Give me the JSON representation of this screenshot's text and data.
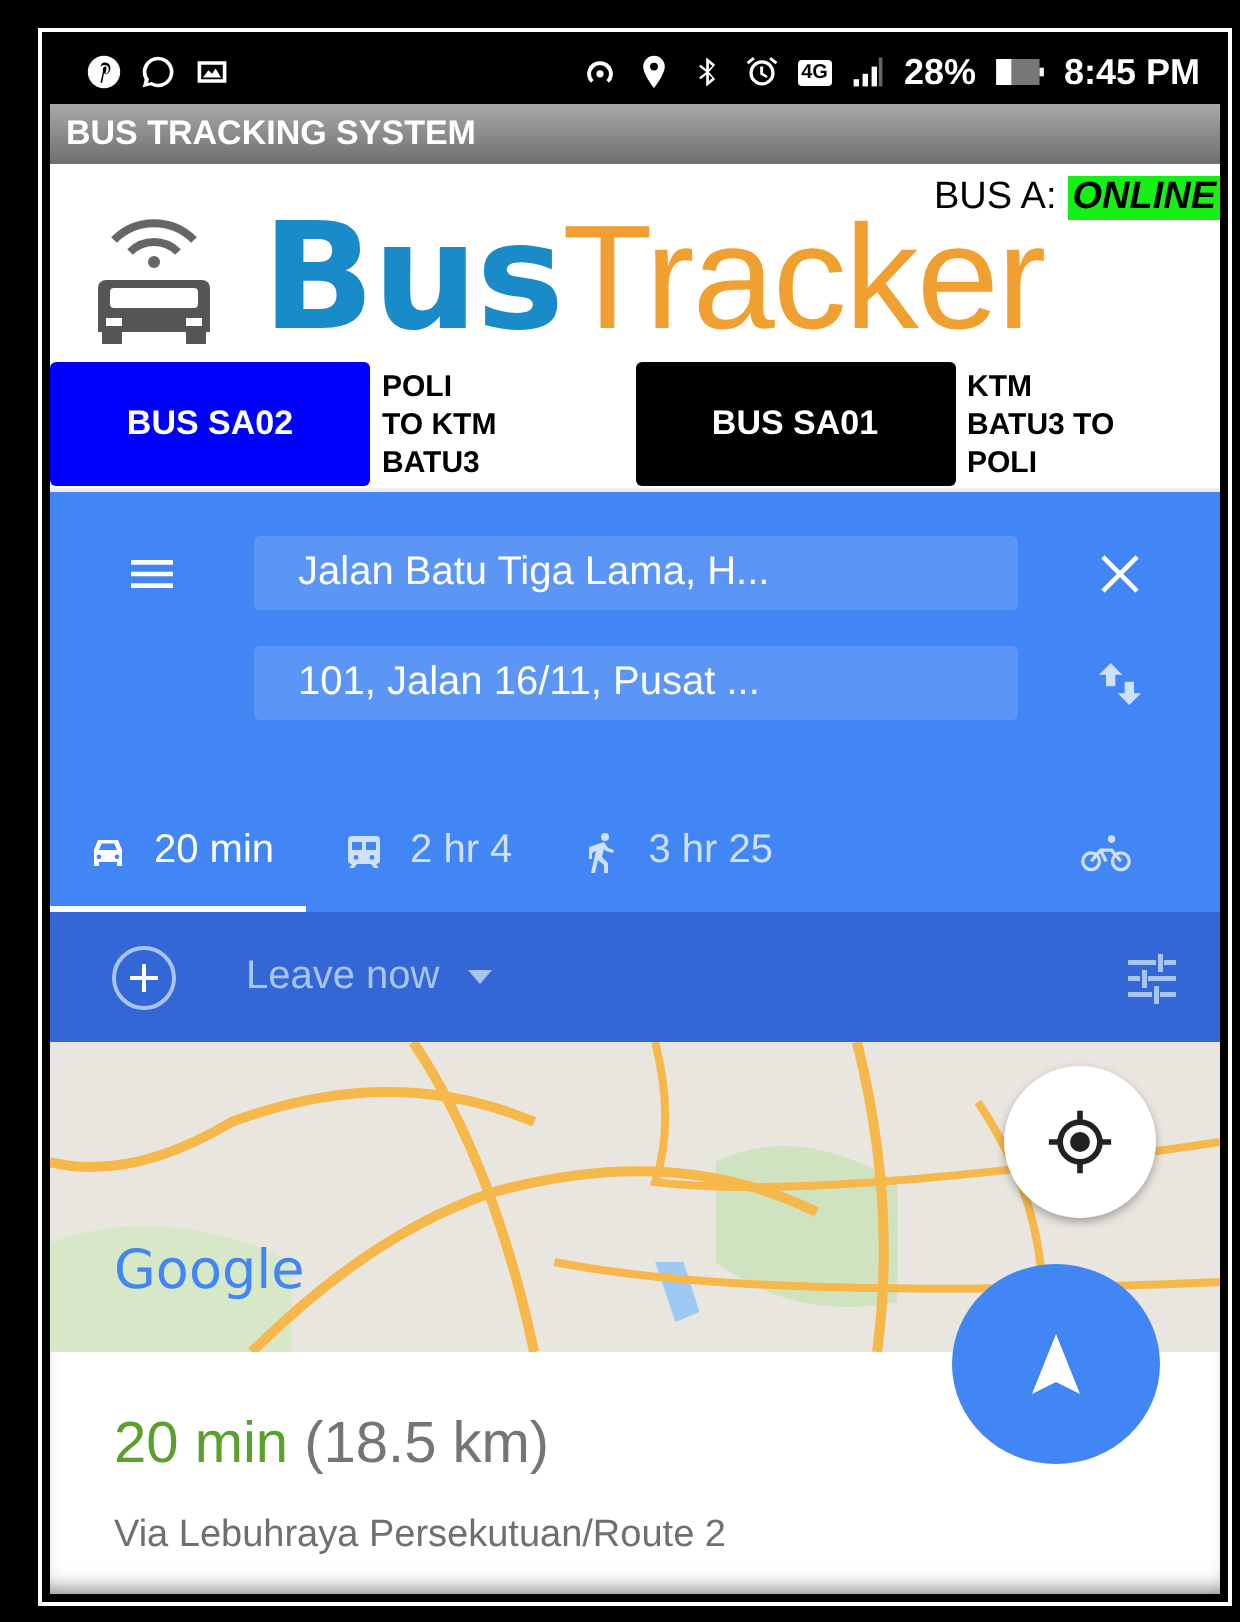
{
  "status_bar": {
    "network": "4G",
    "battery": "28%",
    "time": "8:45 PM"
  },
  "app_bar": {
    "title": "BUS TRACKING SYSTEM"
  },
  "header": {
    "bus_label": "BUS A:",
    "bus_status": "ONLINE",
    "logo_first": "Bus",
    "logo_second": "Tracker"
  },
  "buses": [
    {
      "label": "BUS SA02",
      "route": "POLI\nTO KTM\nBATU3",
      "color": "#0000ff"
    },
    {
      "label": "BUS SA01",
      "route": "KTM\nBATU3 TO\nPOLI",
      "color": "#000000"
    }
  ],
  "directions": {
    "from": "Jalan Batu Tiga Lama, H...",
    "to": "101, Jalan 16/11, Pusat ..."
  },
  "modes": [
    {
      "kind": "car",
      "label": "20 min",
      "selected": true
    },
    {
      "kind": "transit",
      "label": "2 hr 4",
      "selected": false
    },
    {
      "kind": "walk",
      "label": "3 hr 25",
      "selected": false
    },
    {
      "kind": "bike",
      "selected": false
    }
  ],
  "options": {
    "depart": "Leave now"
  },
  "map": {
    "attribution": "Google"
  },
  "result": {
    "duration": "20 min",
    "distance": "(18.5 km)",
    "via": "Via Lebuhraya Persekutuan/Route 2"
  }
}
